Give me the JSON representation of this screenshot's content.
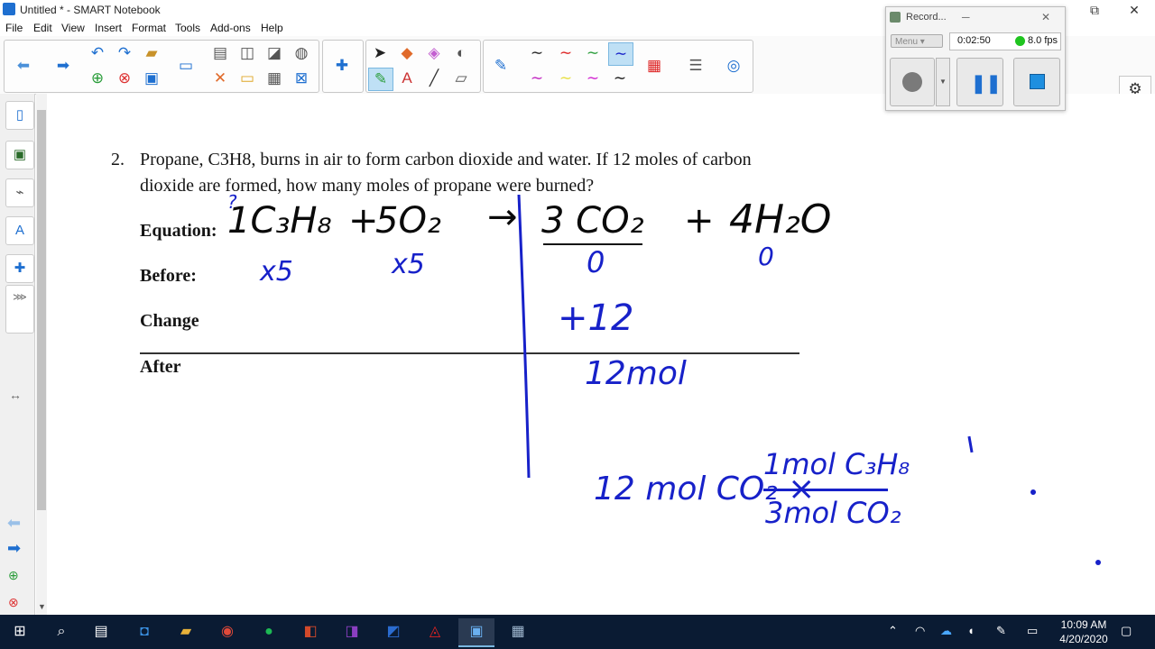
{
  "window": {
    "title": "Untitled * - SMART Notebook",
    "restore_glyph": "⧉",
    "close_glyph": "✕"
  },
  "menu": [
    "File",
    "Edit",
    "View",
    "Insert",
    "Format",
    "Tools",
    "Add-ons",
    "Help"
  ],
  "recorder": {
    "title": "Record...",
    "menu_label": "Menu",
    "time": "0:02:50",
    "fps": "8.0 fps",
    "minimize": "─",
    "close": "✕"
  },
  "question": {
    "number": "2.",
    "line1": "Propane, C3H8, burns in air to form carbon dioxide and water. If 12 moles of carbon",
    "line2": "dioxide are formed, how many moles of propane were burned?"
  },
  "labels": {
    "equation": "Equation:",
    "before": "Before:",
    "change": "Change",
    "after": "After"
  },
  "handwriting": {
    "coef_q": "?",
    "propane": "1C₃H₈",
    "plus1": "+",
    "o2": "5O₂",
    "arrow": "→",
    "co2": "3 CO₂",
    "plus2": "+",
    "h2o": "4H₂O",
    "x5_1": "x5",
    "x5_2": "x5",
    "zero1": "0",
    "zero2": "0",
    "plus12": "+12",
    "after12": "12mol",
    "calc_left": "12 mol CO₂ ×",
    "calc_num": "1mol C₃H₈",
    "calc_den": "3mol CO₂"
  },
  "tray": {
    "time": "10:09 AM",
    "date": "4/20/2020"
  },
  "colors": {
    "ink_blue": "#1721c9",
    "taskbar": "#0a1b33",
    "accent": "#1e6fd0"
  }
}
